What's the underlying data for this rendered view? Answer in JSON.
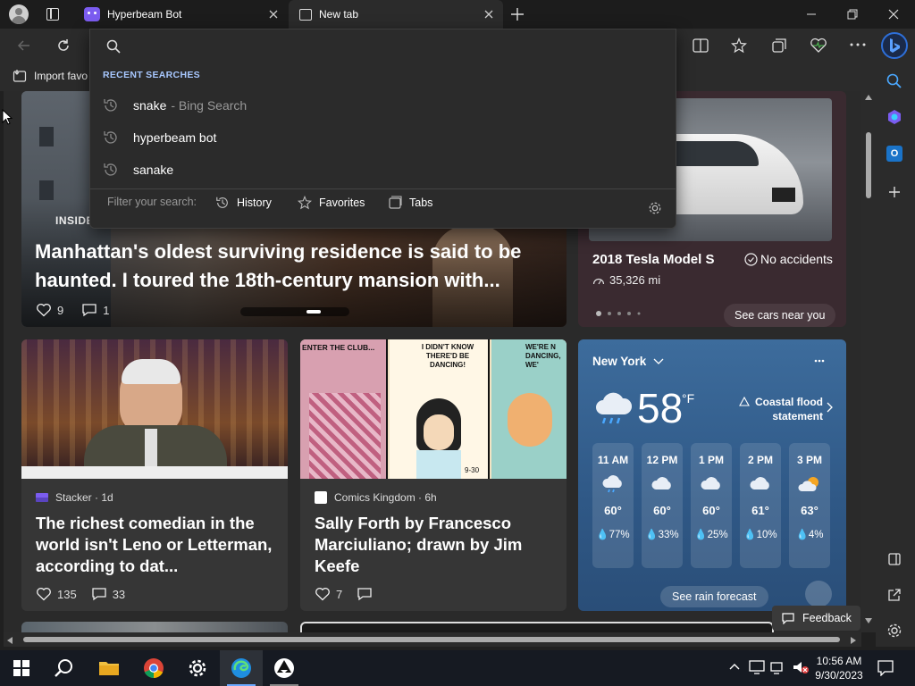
{
  "tabs": [
    {
      "title": "Hyperbeam Bot",
      "active": false
    },
    {
      "title": "New tab",
      "active": true
    }
  ],
  "favbar": {
    "import_label": "Import favo"
  },
  "dropdown": {
    "section_label": "RECENT SEARCHES",
    "items": [
      {
        "text": "snake",
        "suffix": "- Bing Search"
      },
      {
        "text": "hyperbeam bot",
        "suffix": ""
      },
      {
        "text": "sanake",
        "suffix": ""
      }
    ],
    "filter_label": "Filter your search:",
    "filters": [
      "History",
      "Favorites",
      "Tabs"
    ]
  },
  "hero": {
    "tag": "INSIDE",
    "title": "Manhattan's oldest surviving residence is said to be haunted. I toured the 18th-century mansion with...",
    "likes": "9",
    "comments": "1"
  },
  "car": {
    "title": "2018 Tesla Model S",
    "badge": "No accidents",
    "mileage": "35,326 mi",
    "cta": "See cars near you"
  },
  "card1": {
    "source": "Stacker · 1d",
    "title": "The richest comedian in the world isn't Leno or Letterman, according to dat...",
    "likes": "135",
    "comments": "33"
  },
  "card2": {
    "source": "Comics Kingdom · 6h",
    "title": "Sally Forth by Francesco Marciuliano; drawn by Jim Keefe",
    "likes": "7",
    "comic_texts": [
      "ENTER THE CLUB...",
      "I DIDN'T KNOW THERE'D BE DANCING!",
      "WE'RE N DANCING, WE'",
      "9-30"
    ]
  },
  "weather": {
    "location": "New York",
    "temp": "58",
    "unit": "°F",
    "alert": "Coastal flood statement",
    "hours": [
      {
        "time": "11 AM",
        "temp": "60°",
        "precip": "77%"
      },
      {
        "time": "12 PM",
        "temp": "60°",
        "precip": "33%"
      },
      {
        "time": "1 PM",
        "temp": "60°",
        "precip": "25%"
      },
      {
        "time": "2 PM",
        "temp": "61°",
        "precip": "10%"
      },
      {
        "time": "3 PM",
        "temp": "63°",
        "precip": "4%"
      }
    ],
    "cta": "See rain forecast"
  },
  "feedback": {
    "label": "Feedback"
  },
  "clock": {
    "time": "10:56 AM",
    "date": "9/30/2023"
  }
}
